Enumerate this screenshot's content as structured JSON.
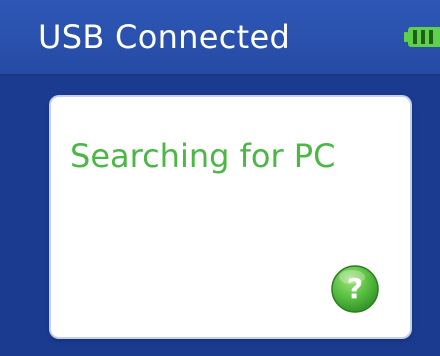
{
  "header": {
    "title": "USB Connected",
    "battery_icon": "battery-full-icon",
    "battery_level": 1.0
  },
  "dialog": {
    "message": "Searching for PC",
    "help_icon": "help-question-icon",
    "help_label": "?"
  },
  "colors": {
    "background": "#1a3b8f",
    "header": "#2a51ad",
    "accent_green": "#4bb845",
    "card": "#ffffff"
  }
}
